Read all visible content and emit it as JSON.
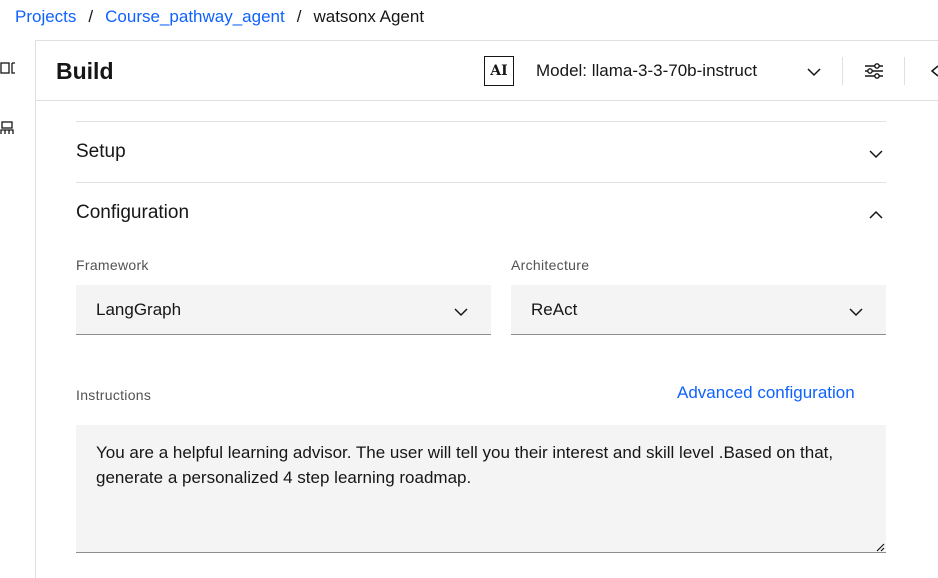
{
  "breadcrumb": {
    "items": [
      "Projects",
      "Course_pathway_agent"
    ],
    "separator": "/",
    "current": "watsonx Agent"
  },
  "header": {
    "title": "Build",
    "ai_badge": "AI",
    "model_label": "Model: llama-3-3-70b-instruct"
  },
  "rail": {
    "icons": [
      "layout-icon",
      "robot-icon"
    ]
  },
  "sections": {
    "setup": {
      "title": "Setup",
      "expanded": false
    },
    "configuration": {
      "title": "Configuration",
      "expanded": true
    }
  },
  "configuration": {
    "framework": {
      "label": "Framework",
      "value": "LangGraph"
    },
    "architecture": {
      "label": "Architecture",
      "value": "ReAct"
    },
    "instructions": {
      "label": "Instructions",
      "advanced_link": "Advanced configuration",
      "value": "You are a helpful learning advisor. The user will tell you their interest and skill level .Based on that, generate a personalized 4 step learning roadmap."
    }
  },
  "colors": {
    "link": "#0f62fe",
    "field_bg": "#f4f4f4",
    "border": "#e0e0e0",
    "text": "#161616",
    "label": "#525252"
  }
}
